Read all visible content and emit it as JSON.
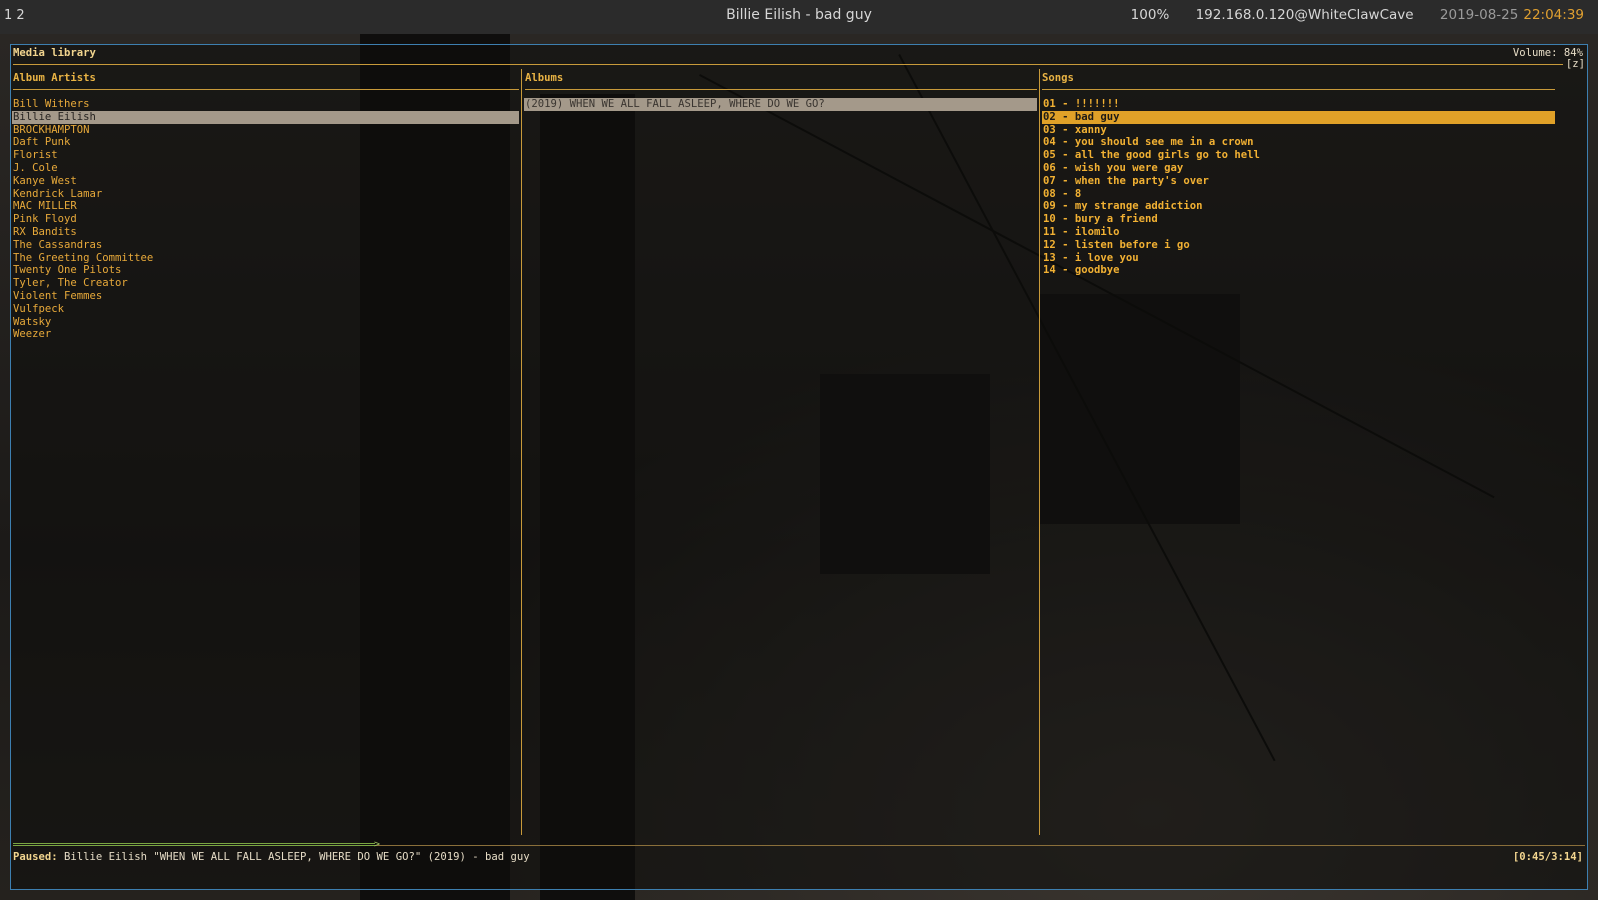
{
  "topbar": {
    "workspaces": "1 2",
    "window_title": "Billie Eilish - bad guy",
    "battery": "100%",
    "host": "192.168.0.120@WhiteClawCave",
    "date": "2019-08-25",
    "time": "22:04:39"
  },
  "header": {
    "title": "Media library",
    "volume": "Volume: 84%",
    "mode": "[z]"
  },
  "columns": {
    "artists": "Album Artists",
    "albums": "Albums",
    "songs": "Songs"
  },
  "artists": [
    "Bill Withers",
    "Billie Eilish",
    "BROCKHAMPTON",
    "Daft Punk",
    "Florist",
    "J. Cole",
    "Kanye West",
    "Kendrick Lamar",
    "MAC MILLER",
    "Pink Floyd",
    "RX Bandits",
    "The Cassandras",
    "The Greeting Committee",
    "Twenty One Pilots",
    "Tyler, The Creator",
    "Violent Femmes",
    "Vulfpeck",
    "Watsky",
    "Weezer"
  ],
  "albums": [
    "(2019) WHEN WE ALL FALL ASLEEP, WHERE DO WE GO?"
  ],
  "songs": [
    "01 - !!!!!!!",
    "02 - bad guy",
    "03 - xanny",
    "04 - you should see me in a crown",
    "05 - all the good girls go to hell",
    "06 - wish you were gay",
    "07 - when the party's over",
    "08 - 8",
    "09 - my strange addiction",
    "10 - bury a friend",
    "11 - ilomilo",
    "12 - listen before i go",
    "13 - i love you",
    "14 - goodbye"
  ],
  "selected_artist_index": 1,
  "playing_song_index": 1,
  "status": {
    "state": "Paused:",
    "track": " Billie Eilish \"WHEN WE ALL FALL ASLEEP, WHERE DO WE GO?\" (2019) - bad guy",
    "elapsed": "[0:45/3:14]",
    "progress_fraction": 0.23
  }
}
